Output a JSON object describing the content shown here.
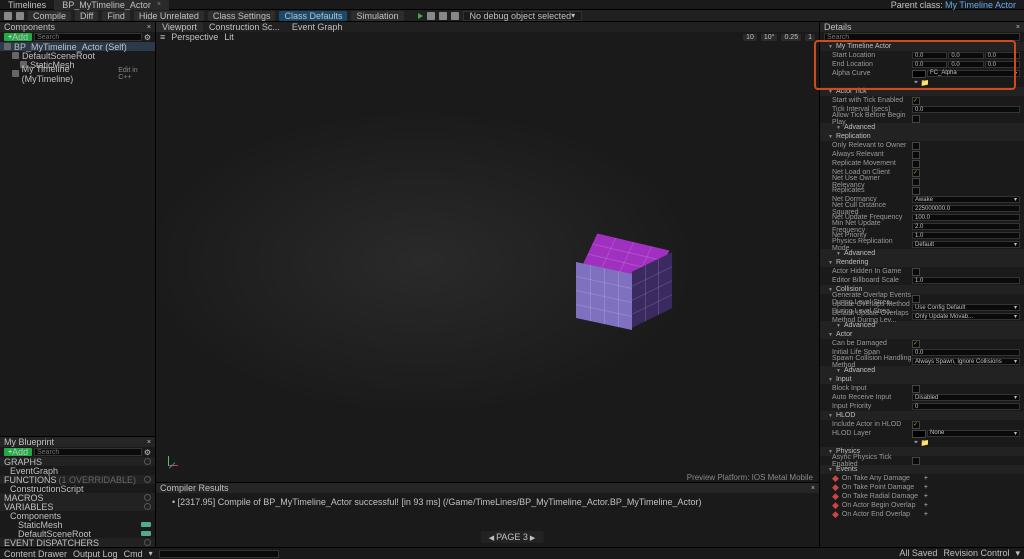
{
  "tabs": {
    "timelines": "Timelines",
    "bp": "BP_MyTimeline_Actor"
  },
  "parent_class_label": "Parent class:",
  "parent_class": "My Timeline Actor",
  "toolbar": {
    "compile": "Compile",
    "diff": "Diff",
    "find": "Find",
    "hide_unrelated": "Hide Unrelated",
    "class_settings": "Class Settings",
    "class_defaults": "Class Defaults",
    "simulation": "Simulation",
    "no_debug": "No debug object selected"
  },
  "vp_tabs": {
    "viewport": "Viewport",
    "construction": "Construction Sc...",
    "event_graph": "Event Graph"
  },
  "vp_sub": {
    "perspective": "Perspective",
    "lit": "Lit"
  },
  "vp_stats": {
    "a": "10",
    "b": "10°",
    "c": "0.25",
    "d": "1"
  },
  "vp_footer": "Preview Platform: IOS Metal Mobile",
  "components": {
    "title": "Components",
    "root": "BP_MyTimeline_Actor (Self)",
    "default_root": "DefaultSceneRoot",
    "static_mesh": "StaticMesh",
    "timeline": "My Timeline (MyTimeline)",
    "edit_cpp": "Edit in C++"
  },
  "myblueprint": {
    "title": "My Blueprint",
    "graphs": "GRAPHS",
    "eventgraph": "EventGraph",
    "functions": "FUNCTIONS",
    "func_note": "(1 OVERRIDABLE)",
    "construction_script": "ConstructionScript",
    "macros": "MACROS",
    "variables": "VARIABLES",
    "components_cat": "Components",
    "v_staticmesh": "StaticMesh",
    "v_defroot": "DefaultSceneRoot",
    "dispatchers": "EVENT DISPATCHERS"
  },
  "add": "Add",
  "search_placeholder": "Search",
  "compiler": {
    "title": "Compiler Results",
    "msg": "[2317.95] Compile of BP_MyTimeline_Actor successful! [in 93 ms] (/Game/TimeLines/BP_MyTimeline_Actor.BP_MyTimeline_Actor)"
  },
  "details": {
    "title": "Details",
    "sections": {
      "my_timeline_actor": "My Timeline Actor",
      "start_location": "Start Location",
      "end_location": "End Location",
      "alpha_curve": "Alpha Curve",
      "fc_alpha": "FC_Alpha",
      "actor_tick": "Actor Tick",
      "start_tick": "Start with Tick Enabled",
      "tick_interval": "Tick Interval (secs)",
      "allow_tick_before": "Allow Tick Before Begin Play",
      "advanced": "Advanced",
      "replication": "Replication",
      "only_relevant": "Only Relevant to Owner",
      "always_relevant": "Always Relevant",
      "replicate_movement": "Replicate Movement",
      "net_load": "Net Load on Client",
      "net_use_owner": "Net Use Owner Relevancy",
      "replicates": "Replicates",
      "net_dormancy": "Net Dormancy",
      "net_cull": "Net Cull Distance Squared",
      "net_update_freq": "Net Update Frequency",
      "min_net_update": "Min Net Update Frequency",
      "net_priority": "Net Priority",
      "physics_rep_mode": "Physics Replication Mode",
      "rendering": "Rendering",
      "actor_hidden": "Actor Hidden In Game",
      "editor_billboard": "Editor Billboard Scale",
      "collision": "Collision",
      "gen_overlap_load": "Generate Overlap Events During Level Strea...",
      "update_overlaps_load": "Update Overlaps Method During Level Strea...",
      "default_update_overlaps": "Default Update Overlaps Method During Lev...",
      "actor": "Actor",
      "can_be_damaged": "Can be Damaged",
      "initial_lifespan": "Initial Life Span",
      "spawn_collision": "Spawn Collision Handling Method",
      "input": "Input",
      "block_input": "Block Input",
      "auto_receive": "Auto Receive Input",
      "input_priority": "Input Priority",
      "hlod": "HLOD",
      "include_hlod": "Include Actor in HLOD",
      "hlod_layer": "HLOD Layer",
      "physics": "Physics",
      "async_physics": "Async Physics Tick Enabled",
      "events": "Events",
      "on_take_any": "On Take Any Damage",
      "on_take_point": "On Take Point Damage",
      "on_take_radial": "On Take Radial Damage",
      "on_begin_overlap": "On Actor Begin Overlap",
      "on_end_overlap": "On Actor End Overlap"
    },
    "vals": {
      "zero": "0.0",
      "awake": "Awake",
      "net_cull_v": "225000000.0",
      "freq": "100.0",
      "min_freq": "2.0",
      "prio": "1.0",
      "default": "Default",
      "billboard": "1.0",
      "use_config": "Use Config Default",
      "always_spawn": "Always Spawn, Ignore Collisions",
      "disabled": "Disabled",
      "zero_int": "0",
      "none": "None",
      "overlap_method": "Only Update Movab..."
    }
  },
  "page_nav": "PAGE 3",
  "btm": {
    "content_drawer": "Content Drawer",
    "output_log": "Output Log",
    "cmd": "Cmd",
    "all_saved": "All Saved",
    "revision": "Revision Control"
  }
}
